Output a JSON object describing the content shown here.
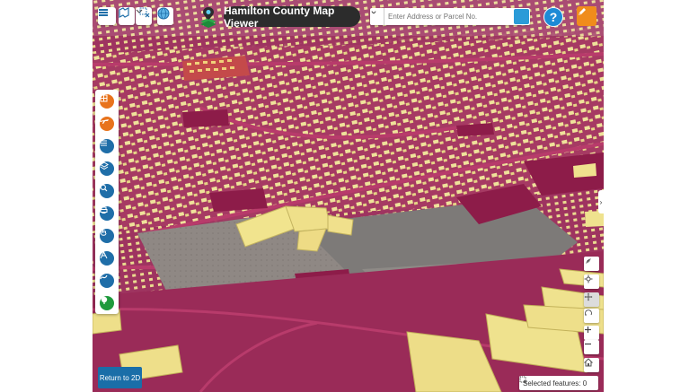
{
  "app": {
    "title": "Hamilton County Map Viewer",
    "search_placeholder": "Enter Address or Parcel No.",
    "help_label": "?",
    "return_2d_label": "Return to 2D",
    "selected_features_label": "Selected features: 0",
    "side_tab_label": "›"
  },
  "topbar_icons": [
    "layer-list-icon",
    "basemap-icon",
    "clear-selection-icon",
    "globe-icon",
    "location-logo-icon"
  ],
  "tools": [
    {
      "name": "tool-parcel-icon",
      "color": "#e8731c"
    },
    {
      "name": "tool-aerial-icon",
      "color": "#e8731c"
    },
    {
      "name": "tool-list-icon",
      "color": "#1f6ea8"
    },
    {
      "name": "tool-layers-icon",
      "color": "#1f6ea8"
    },
    {
      "name": "tool-search-icon",
      "color": "#1f6ea8"
    },
    {
      "name": "tool-print-icon",
      "color": "#1f6ea8"
    },
    {
      "name": "tool-hand-icon",
      "color": "#1f6ea8"
    },
    {
      "name": "tool-measure-icon",
      "color": "#1f6ea8"
    },
    {
      "name": "tool-draw-icon",
      "color": "#1f6ea8"
    },
    {
      "name": "tool-tree-icon",
      "color": "#1e9a3c"
    }
  ],
  "nav_controls": [
    "compass-icon",
    "pan-icon",
    "rotate-icon",
    "orbit-icon",
    "zoom-in-icon",
    "zoom-out-icon",
    "home-icon"
  ],
  "colors": {
    "accent_orange": "#f08c1c",
    "accent_blue": "#1e8ad6",
    "title_bg": "#2c2c2c",
    "parcel": "#a02256",
    "building": "#eee396"
  }
}
